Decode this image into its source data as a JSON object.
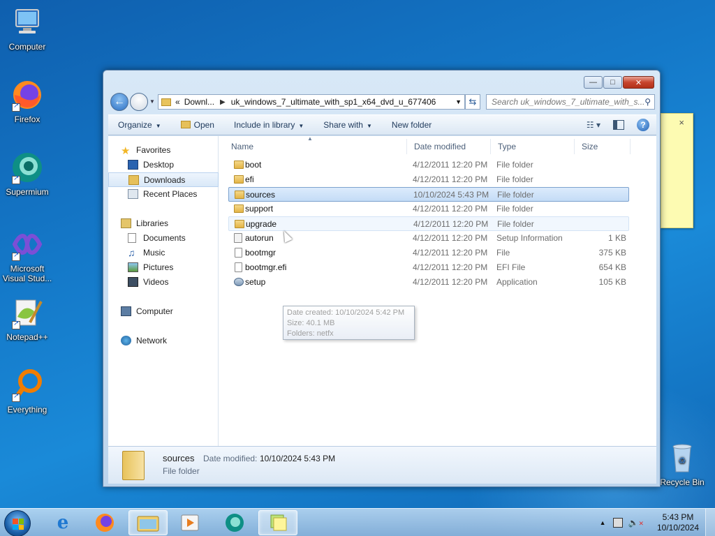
{
  "desktop": {
    "icons": [
      {
        "label": "Computer"
      },
      {
        "label": "Firefox"
      },
      {
        "label": "Supermium"
      },
      {
        "label": "Microsoft Visual Stud..."
      },
      {
        "label": "Notepad++"
      },
      {
        "label": "Everything"
      },
      {
        "label": "Recycle Bin"
      }
    ]
  },
  "sticky_note": {
    "close": "×"
  },
  "window": {
    "controls": {
      "minimize": "—",
      "maximize": "□",
      "close": "✕"
    },
    "address": {
      "overflow": "«",
      "crumb1": "Downl...",
      "crumb2": "uk_windows_7_ultimate_with_sp1_x64_dvd_u_677406"
    },
    "search_placeholder": "Search uk_windows_7_ultimate_with_s...",
    "toolbar": {
      "organize": "Organize",
      "open": "Open",
      "include": "Include in library",
      "share": "Share with",
      "new_folder": "New folder"
    },
    "nav": {
      "favorites": "Favorites",
      "desktop": "Desktop",
      "downloads": "Downloads",
      "recent": "Recent Places",
      "libraries": "Libraries",
      "documents": "Documents",
      "music": "Music",
      "pictures": "Pictures",
      "videos": "Videos",
      "computer": "Computer",
      "network": "Network"
    },
    "columns": {
      "name": "Name",
      "date": "Date modified",
      "type": "Type",
      "size": "Size"
    },
    "files": [
      {
        "name": "boot",
        "date": "4/12/2011 12:20 PM",
        "type": "File folder",
        "size": "",
        "icon": "folder"
      },
      {
        "name": "efi",
        "date": "4/12/2011 12:20 PM",
        "type": "File folder",
        "size": "",
        "icon": "folder"
      },
      {
        "name": "sources",
        "date": "10/10/2024 5:43 PM",
        "type": "File folder",
        "size": "",
        "icon": "folder"
      },
      {
        "name": "support",
        "date": "4/12/2011 12:20 PM",
        "type": "File folder",
        "size": "",
        "icon": "folder"
      },
      {
        "name": "upgrade",
        "date": "4/12/2011 12:20 PM",
        "type": "File folder",
        "size": "",
        "icon": "folder"
      },
      {
        "name": "autorun",
        "date": "4/12/2011 12:20 PM",
        "type": "Setup Information",
        "size": "1 KB",
        "icon": "inf"
      },
      {
        "name": "bootmgr",
        "date": "4/12/2011 12:20 PM",
        "type": "File",
        "size": "375 KB",
        "icon": "file"
      },
      {
        "name": "bootmgr.efi",
        "date": "4/12/2011 12:20 PM",
        "type": "EFI File",
        "size": "654 KB",
        "icon": "file"
      },
      {
        "name": "setup",
        "date": "4/12/2011 12:20 PM",
        "type": "Application",
        "size": "105 KB",
        "icon": "setup"
      }
    ],
    "tooltip": {
      "line1": "Date created: 10/10/2024 5:42 PM",
      "line2": "Size: 40.1 MB",
      "line3": "Folders: netfx"
    },
    "details": {
      "name": "sources",
      "modified_label": "Date modified:",
      "modified_value": "10/10/2024 5:43 PM",
      "type": "File folder"
    }
  },
  "taskbar": {
    "clock_time": "5:43 PM",
    "clock_date": "10/10/2024",
    "tray_arrow": "▲"
  }
}
